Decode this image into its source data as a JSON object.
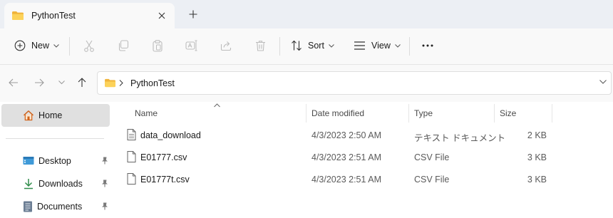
{
  "window": {
    "tab_title": "PythonTest",
    "tab_icon": "folder-icon",
    "close_icon": "close-icon",
    "new_tab_icon": "plus-icon"
  },
  "toolbar": {
    "new_label": "New",
    "sort_label": "Sort",
    "view_label": "View",
    "more_label": "···",
    "icons": [
      "plus-circle-icon",
      "cut-icon",
      "copy-icon",
      "paste-icon",
      "rename-icon",
      "share-icon",
      "delete-icon",
      "sort-icon",
      "view-icon",
      "more-icon"
    ]
  },
  "address": {
    "breadcrumb": "PythonTest"
  },
  "sidebar": {
    "home_label": "Home",
    "items": [
      {
        "label": "Desktop",
        "icon": "desktop-icon",
        "pinned": true
      },
      {
        "label": "Downloads",
        "icon": "download-icon",
        "pinned": true
      },
      {
        "label": "Documents",
        "icon": "documents-icon",
        "pinned": true
      }
    ]
  },
  "columns": {
    "name": "Name",
    "date": "Date modified",
    "type": "Type",
    "size": "Size"
  },
  "files": [
    {
      "name": "data_download",
      "date": "4/3/2023 2:50 AM",
      "type": "テキスト ドキュメント",
      "size": "2 KB"
    },
    {
      "name": "E01777.csv",
      "date": "4/3/2023 2:51 AM",
      "type": "CSV File",
      "size": "3 KB"
    },
    {
      "name": "E01777t.csv",
      "date": "4/3/2023 2:51 AM",
      "type": "CSV File",
      "size": "3 KB"
    }
  ],
  "colors": {
    "accent": "#0067c0",
    "folder_yellow": "#f8c93f",
    "selected_bg": "#e0e0e0",
    "disabled_icon": "#bdbdbd"
  }
}
